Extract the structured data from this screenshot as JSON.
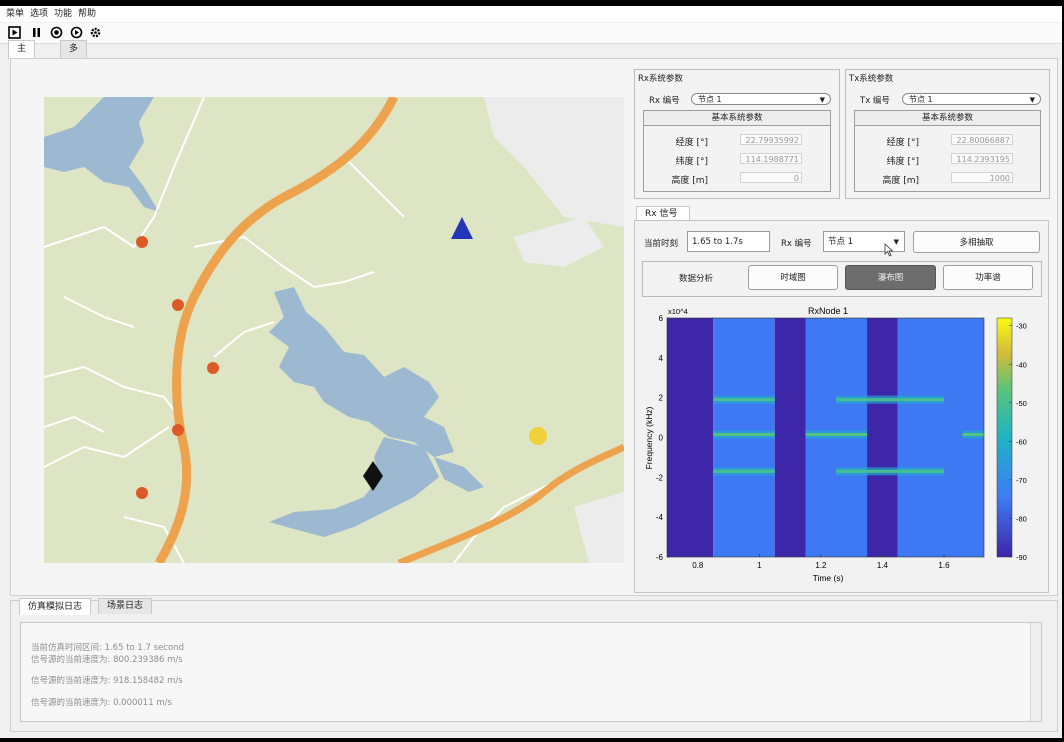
{
  "menu": [
    "菜单",
    "选项",
    "功能",
    "帮助"
  ],
  "toolbar_icons": [
    "play-icon",
    "pause-icon",
    "record-icon",
    "step-icon",
    "gear-icon"
  ],
  "main_tabs": [
    "主界面",
    "多相抽取"
  ],
  "rx_params": {
    "title": "Rx系统参数",
    "id_label": "Rx 编号",
    "id_value": "节点 1",
    "box_title": "基本系统参数",
    "rows": [
      {
        "label": "经度 [°]",
        "value": "22.79935992"
      },
      {
        "label": "纬度 [°]",
        "value": "114.1988771"
      },
      {
        "label": "高度 [m]",
        "value": "0"
      }
    ]
  },
  "tx_params": {
    "title": "Tx系统参数",
    "id_label": "Tx 编号",
    "id_value": "节点 1",
    "box_title": "基本系统参数",
    "rows": [
      {
        "label": "经度 [°]",
        "value": "22.80066887"
      },
      {
        "label": "纬度 [°]",
        "value": "114.2393195"
      },
      {
        "label": "高度 [m]",
        "value": "1000"
      }
    ]
  },
  "rx_signal": {
    "tab": "Rx 信号",
    "time_label": "当前时刻",
    "time_value": "1.65 to 1.7s",
    "id_label": "Rx 编号",
    "id_value": "节点 1",
    "polyphase_btn": "多相抽取",
    "analysis_label": "数据分析",
    "buttons": [
      "时域图",
      "瀑布图",
      "功率谱"
    ]
  },
  "chart_data": {
    "type": "heatmap",
    "title": "RxNode 1",
    "xlabel": "Time (s)",
    "ylabel": "Frequency (kHz)",
    "y_exponent": "x10^4",
    "xlim": [
      0.7,
      1.73
    ],
    "ylim": [
      -6,
      6
    ],
    "x_ticks": [
      "0.8",
      "1",
      "1.2",
      "1.4",
      "1.6"
    ],
    "y_ticks": [
      "6",
      "4",
      "2",
      "0",
      "-2",
      "-4",
      "-6"
    ],
    "colorbar_ticks": [
      "-30",
      "-40",
      "-50",
      "-60",
      "-70",
      "-80",
      "-90"
    ],
    "colorbar_range": [
      -90,
      -28
    ],
    "blocks": [
      {
        "t0": 0.7,
        "t1": 0.85,
        "level": -90
      },
      {
        "t0": 0.85,
        "t1": 1.05,
        "level": -75
      },
      {
        "t0": 1.05,
        "t1": 1.15,
        "level": -90
      },
      {
        "t0": 1.15,
        "t1": 1.35,
        "level": -75
      },
      {
        "t0": 1.35,
        "t1": 1.45,
        "level": -90
      },
      {
        "t0": 1.45,
        "t1": 1.73,
        "level": -75
      }
    ],
    "signals": [
      {
        "t0": 0.85,
        "t1": 1.05,
        "freq": 1.9,
        "level": -50
      },
      {
        "t0": 0.85,
        "t1": 1.05,
        "freq": 0.15,
        "level": -48
      },
      {
        "t0": 0.85,
        "t1": 1.05,
        "freq": -1.7,
        "level": -50
      },
      {
        "t0": 1.15,
        "t1": 1.35,
        "freq": 0.15,
        "level": -48
      },
      {
        "t0": 1.25,
        "t1": 1.45,
        "freq": 1.9,
        "level": -50
      },
      {
        "t0": 1.25,
        "t1": 1.45,
        "freq": -1.7,
        "level": -50
      },
      {
        "t0": 1.45,
        "t1": 1.6,
        "freq": 1.9,
        "level": -50
      },
      {
        "t0": 1.45,
        "t1": 1.6,
        "freq": -1.7,
        "level": -50
      },
      {
        "t0": 1.66,
        "t1": 1.73,
        "freq": 0.15,
        "level": -48
      }
    ]
  },
  "log_tabs": [
    "仿真模拟日志",
    "场景日志"
  ],
  "log_lines": [
    "当前仿真时间区间: 1.65 to 1.7 second",
    "信号源的当前速度为: 800.239386 m/s",
    "信号源的当前速度为: 918.158482 m/s",
    "信号源的当前速度为: 0.000011 m/s"
  ]
}
